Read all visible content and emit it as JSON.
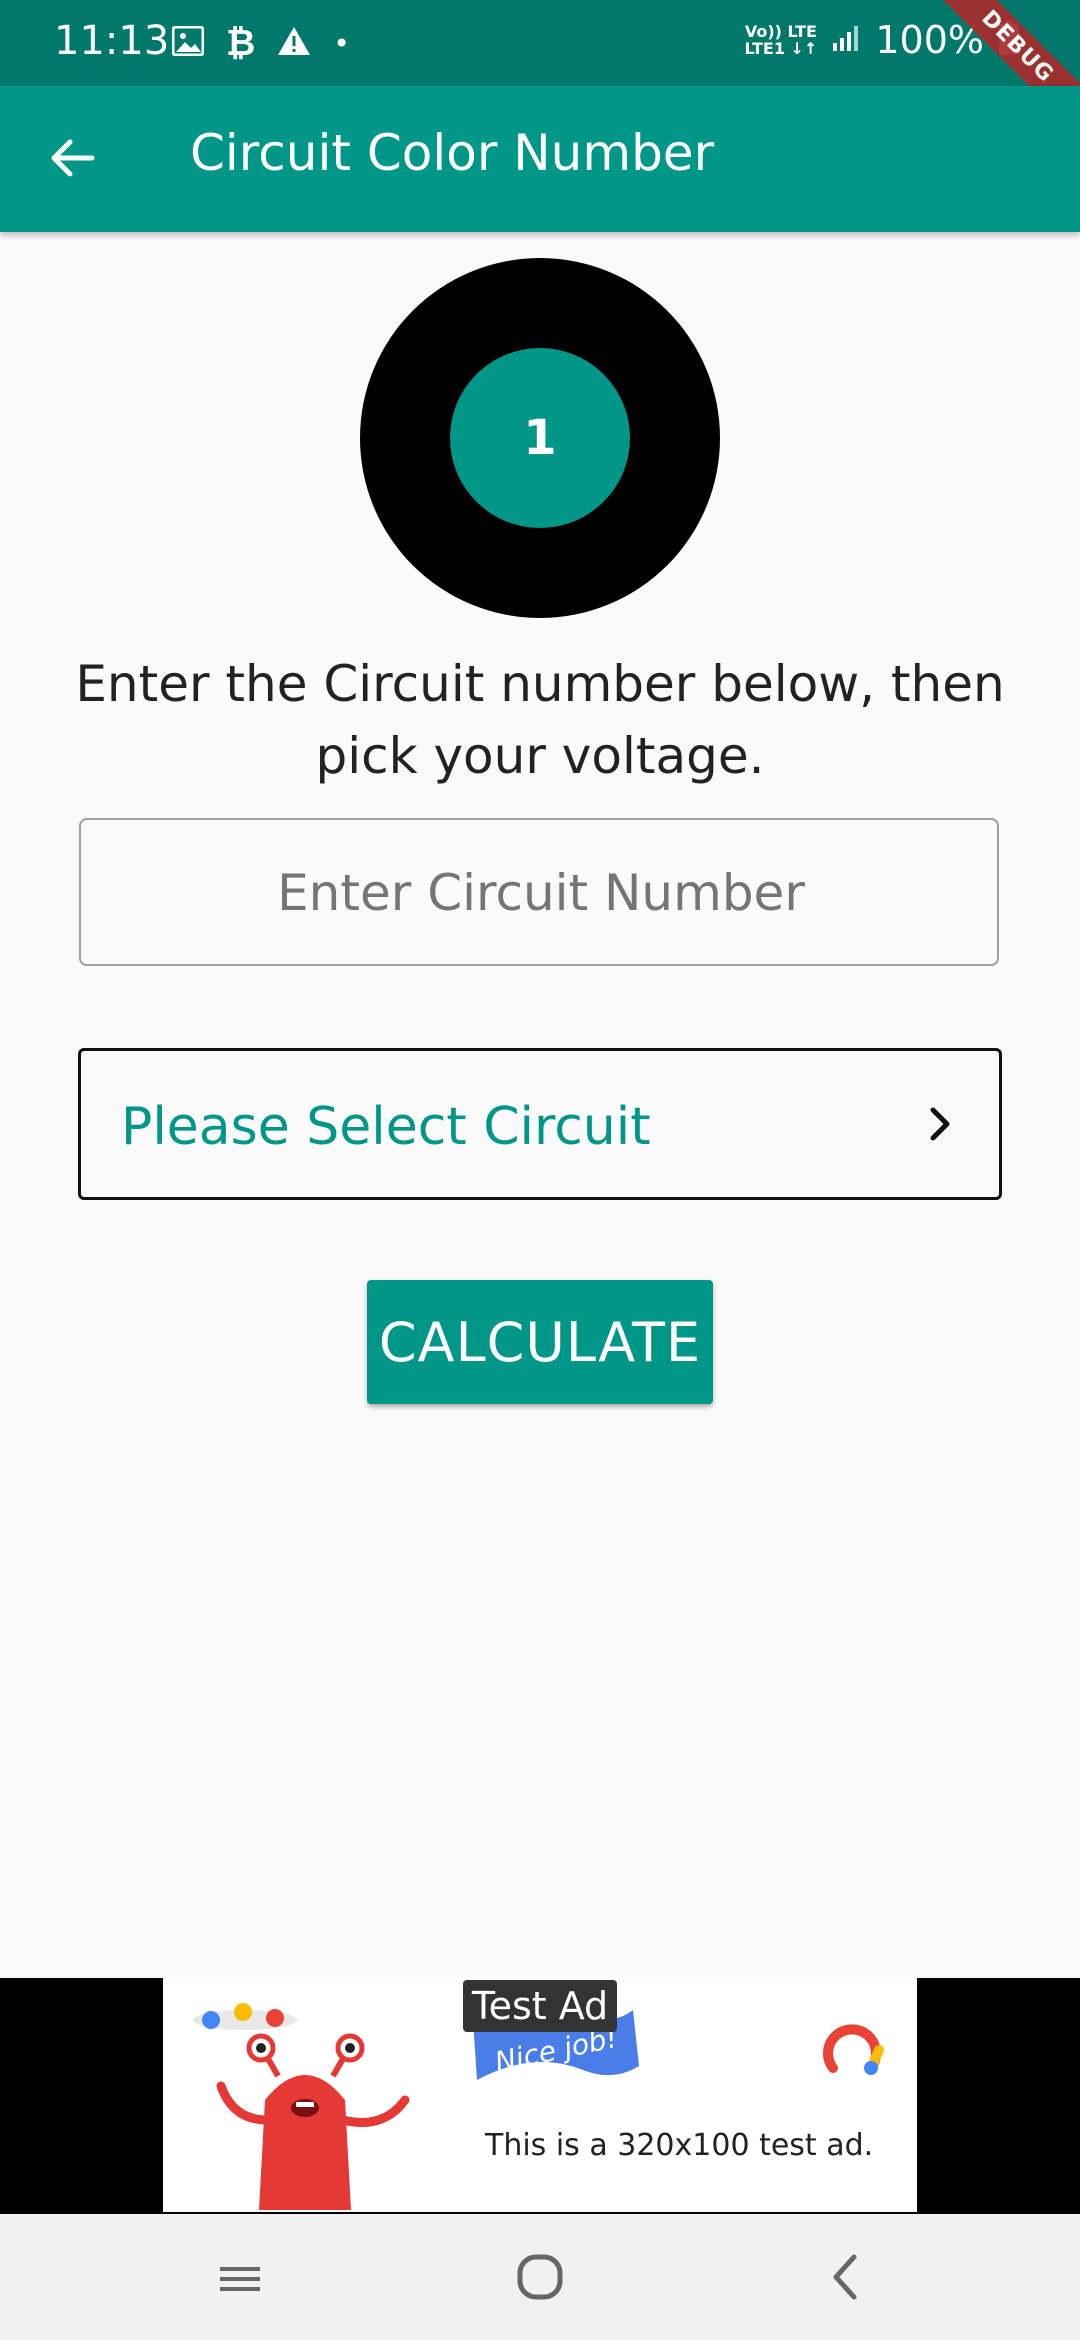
{
  "status_bar": {
    "time": "11:13",
    "network_label": "Vo)) LTE\nLTE1 ↓↑",
    "battery": "100%",
    "icons": [
      "image-icon",
      "bitcoin-icon",
      "warning-icon",
      "dot-icon",
      "signal-icon",
      "battery-icon"
    ]
  },
  "debug_banner": "DEBUG",
  "app_bar": {
    "title": "Circuit Color Number",
    "back_icon": "arrow-back-icon"
  },
  "circuit_display": {
    "number": "1",
    "ring_color": "#000000",
    "inner_color": "#009688"
  },
  "instruction": "Enter the Circuit number below, then pick your voltage.",
  "circuit_input": {
    "value": "",
    "placeholder": "Enter Circuit Number"
  },
  "circuit_select": {
    "label": "Please Select Circuit",
    "icon": "chevron-right-icon"
  },
  "calculate_button": {
    "label": "CALCULATE"
  },
  "ad": {
    "label": "Test Ad",
    "flag_text": "Nice job!",
    "caption": "This is a 320x100 test ad."
  },
  "nav_bar": {
    "buttons": [
      "recent-apps-icon",
      "home-icon",
      "back-icon"
    ]
  },
  "colors": {
    "primary": "#009688",
    "primary_dark": "#00796b",
    "background": "#fafafa"
  }
}
